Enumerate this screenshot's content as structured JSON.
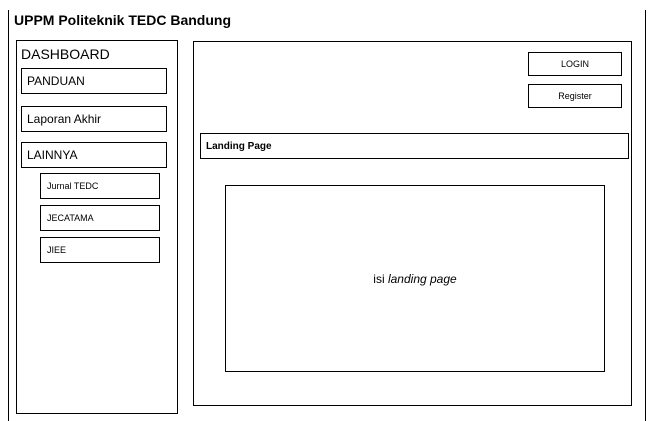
{
  "header": {
    "title": "UPPM Politeknik TEDC Bandung"
  },
  "sidebar": {
    "title": "DASHBOARD",
    "items": [
      {
        "label": "PANDUAN"
      },
      {
        "label": "Laporan Akhir"
      },
      {
        "label": "LAINNYA"
      }
    ],
    "subitems": [
      {
        "label": "Jurnal TEDC"
      },
      {
        "label": "JECATAMA"
      },
      {
        "label": "JIEE"
      }
    ]
  },
  "main": {
    "login_label": "LOGIN",
    "register_label": "Register",
    "section_title": "Landing Page",
    "content_prefix": "isi ",
    "content_emphasis": "landing page"
  }
}
